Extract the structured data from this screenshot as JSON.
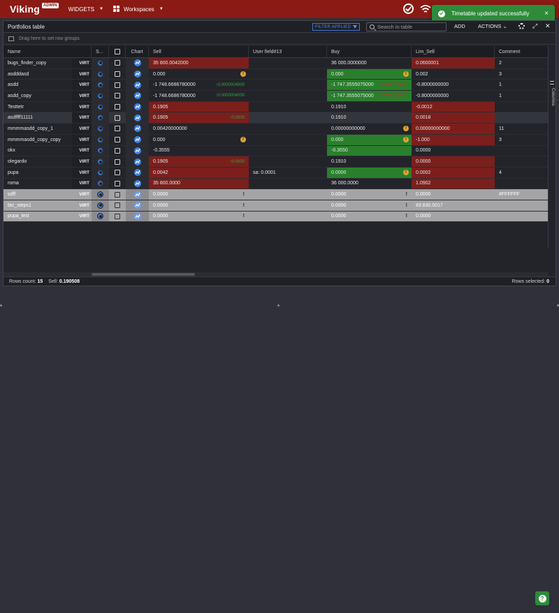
{
  "app": {
    "logo": "Viking",
    "badge": "ADMIN",
    "nav_widgets": "WIDGETS",
    "nav_workspaces": "Workspaces"
  },
  "toast": {
    "message": "Timetable updated successfully",
    "close": "×"
  },
  "panel": {
    "title": "Portfolios table",
    "filter_badge": "FILTER APPLIED",
    "search_placeholder": "Search in table",
    "add": "ADD",
    "actions": "ACTIONS",
    "group_hint": "Drag here to set row groups",
    "columns_tab": "Columns"
  },
  "columns": {
    "name": "Name",
    "s": "S...",
    "chart": "Chart",
    "sell": "Sell",
    "user_field": "User field#13",
    "buy": "Buy",
    "lim_sell": "Lim_Sell",
    "comment": "Comment"
  },
  "rows": [
    {
      "name": "bugs_finder_copy",
      "virt": "VIRT",
      "sell": "35 800.0042000",
      "sell_style": "red",
      "uf": "",
      "buy": "36 000.0000000",
      "buy_style": "",
      "lim": "0.0600001",
      "lim_style": "red",
      "comment": "2"
    },
    {
      "name": "asdddasd",
      "virt": "VIRT",
      "sell": "0.000",
      "sell_style": "",
      "sell_warn": "!",
      "uf": "",
      "buy": "0.000",
      "buy_style": "green",
      "buy_warn": "!",
      "lim": "0.002",
      "lim_style": "",
      "comment": "3"
    },
    {
      "name": "asdd",
      "virt": "VIRT",
      "sell": "-1 748.6686780000",
      "sell_style": "",
      "sell_sub": "↑0.0000004000",
      "uf": "",
      "buy": "-1 747.3555075000",
      "buy_style": "green",
      "buy_sub": "↓0.0000005000",
      "lim": "-0.8000000000",
      "lim_style": "",
      "comment": "1"
    },
    {
      "name": "asdd_copy",
      "virt": "VIRT",
      "sell": "-1 748.6686780000",
      "sell_style": "",
      "sell_sub": "↑0.0000004000",
      "uf": "",
      "buy": "-1 747.3555075000",
      "buy_style": "green",
      "buy_sub": "↓0.0000005000",
      "lim": "-0.8000000000",
      "lim_style": "",
      "comment": "1"
    },
    {
      "name": "Testtetr",
      "virt": "VIRT",
      "sell": "0.1905",
      "sell_style": "red",
      "uf": "",
      "buy": "0.1910",
      "buy_style": "",
      "lim": "-0.0012",
      "lim_style": "red",
      "comment": ""
    },
    {
      "name": "asdffff11111",
      "virt": "VIRT",
      "sell": "0.1905",
      "sell_style": "red",
      "sell_sub": "↑0.0000",
      "uf": "",
      "buy": "0.1910",
      "buy_style": "",
      "lim": "0.0018",
      "lim_style": "red",
      "comment": "",
      "highlight": true
    },
    {
      "name": "mmmmasdd_copy_1",
      "virt": "VIRT",
      "sell": "0.00420000000",
      "sell_style": "",
      "uf": "",
      "buy": "0.00000000000",
      "buy_style": "",
      "buy_warn": "!",
      "lim": "0.00000000000",
      "lim_style": "red",
      "comment": "11"
    },
    {
      "name": "mmmmasdd_copy_copy",
      "virt": "VIRT",
      "sell": "0.000",
      "sell_style": "",
      "sell_warn": "!",
      "uf": "",
      "buy": "0.000",
      "buy_style": "green",
      "buy_warn": "!",
      "lim": "-1.000",
      "lim_style": "red",
      "comment": "3"
    },
    {
      "name": "okx",
      "virt": "VIRT",
      "sell": "-0.3555",
      "sell_style": "",
      "uf": "",
      "buy": "-0.3550",
      "buy_style": "green",
      "lim": "0.0000",
      "lim_style": "",
      "comment": ""
    },
    {
      "name": "olegardo",
      "virt": "VIRT",
      "sell": "0.1905",
      "sell_style": "red",
      "sell_sub": "↑0.0000",
      "uf": "",
      "buy": "0.1910",
      "buy_style": "",
      "lim": "0.0000",
      "lim_style": "red",
      "comment": ""
    },
    {
      "name": "pupa",
      "virt": "VIRT",
      "sell": "0.0042",
      "sell_style": "red",
      "uf": "sa: 0.0001",
      "buy": "0.0000",
      "buy_style": "green",
      "buy_warn": "!",
      "lim": "0.0002",
      "lim_style": "red",
      "comment": "4"
    },
    {
      "name": "roma",
      "virt": "VIRT",
      "sell": "35 800.0000",
      "sell_style": "red",
      "uf": "",
      "buy": "36 000.0000",
      "buy_style": "",
      "lim": "1.0902",
      "lim_style": "red",
      "comment": ""
    },
    {
      "name": "sdff",
      "virt": "VIRT",
      "sell": "0.0000",
      "sell_style": "",
      "sell_excl": "!",
      "uf": "",
      "buy": "0.0000",
      "buy_style": "",
      "buy_excl": "!",
      "lim": "0.0000",
      "lim_style": "",
      "comment": "#FFFFFF",
      "grey": true
    },
    {
      "name": "btc_steps1",
      "virt": "VIRT",
      "sell": "0.0000",
      "sell_style": "",
      "sell_excl": "!",
      "uf": "",
      "buy": "0.0000",
      "buy_style": "",
      "buy_excl": "!",
      "lim": "83 830.0017",
      "lim_style": "",
      "comment": "",
      "grey": true
    },
    {
      "name": "pupa_test",
      "virt": "VIRT",
      "sell": "0.0000",
      "sell_style": "",
      "sell_excl": "!",
      "uf": "",
      "buy": "0.0000",
      "buy_style": "",
      "buy_excl": "!",
      "lim": "0.0000",
      "lim_style": "",
      "comment": "",
      "grey": true
    }
  ],
  "footer": {
    "rows_count_label": "Rows count:",
    "rows_count": "15",
    "sell_label": "Sell:",
    "sell_value": "0.190508",
    "rows_selected_label": "Rows selected:",
    "rows_selected": "0"
  },
  "colors": {
    "topbar": "#8b1a14",
    "toast": "#2e8b3a",
    "cell_red": "#7c1f1c",
    "cell_green": "#2a7f2d",
    "accent_blue": "#3d84e6"
  },
  "icons": [
    "grid-icon",
    "check-circle-icon",
    "wifi-icon",
    "search-icon",
    "funnel-icon",
    "gear-icon",
    "expand-icon",
    "close-icon",
    "chart-icon",
    "help-icon"
  ]
}
